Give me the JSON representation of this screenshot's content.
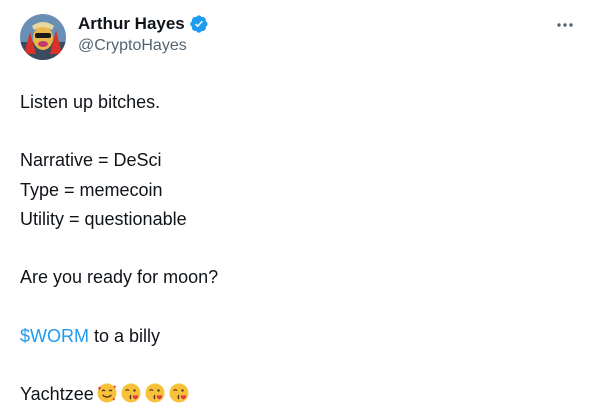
{
  "author": {
    "display_name": "Arthur Hayes",
    "handle": "@CryptoHayes",
    "verified": true,
    "verified_color": "#1d9bf0"
  },
  "icons": {
    "verified": "verified-badge-icon",
    "more": "more-options-icon"
  },
  "tweet": {
    "line1": "Listen up bitches.",
    "line2": "Narrative = DeSci",
    "line3": "Type = memecoin",
    "line4": "Utility = questionable",
    "line5": "Are you ready for moon?",
    "cashtag": "$WORM",
    "line6_rest": " to a billy",
    "line7": "Yachtzee",
    "emojis": [
      "smiling-face-with-hearts",
      "face-blowing-a-kiss",
      "face-blowing-a-kiss",
      "face-blowing-a-kiss"
    ]
  },
  "colors": {
    "text": "#0f1419",
    "secondary": "#536471",
    "link": "#1d9bf0"
  }
}
